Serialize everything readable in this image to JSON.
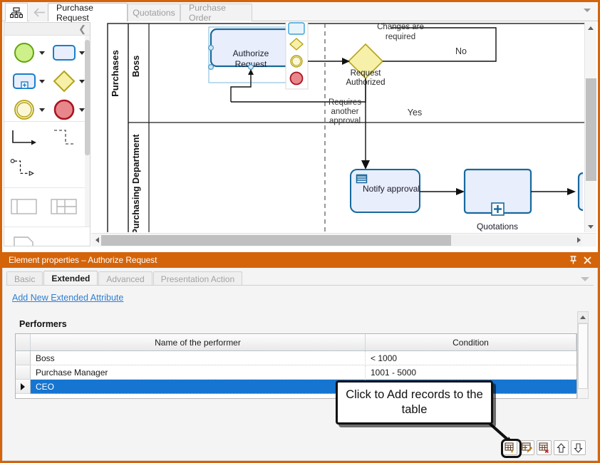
{
  "window": {
    "frame_color": "#d4640a"
  },
  "tabbar": {
    "app_icon": "org-chart-icon",
    "back_icon": "back-arrow-icon",
    "overflow_icon": "chevron-down-icon",
    "tabs": [
      {
        "label": "Purchase Request",
        "active": true
      },
      {
        "label": "Quotations",
        "active": false
      },
      {
        "label": "Purchase Order",
        "active": false
      }
    ]
  },
  "palette": {
    "collapse_icon": "chevron-left-icon",
    "groups": [
      {
        "name": "events-and-activities",
        "items": [
          {
            "icon": "start-event-circle-icon",
            "dropdown": true
          },
          {
            "icon": "task-rounded-rect-icon",
            "dropdown": true
          },
          {
            "icon": "subprocess-icon",
            "dropdown": true
          },
          {
            "icon": "gateway-diamond-icon",
            "dropdown": true
          },
          {
            "icon": "intermediate-event-icon",
            "dropdown": true
          },
          {
            "icon": "end-event-icon",
            "dropdown": true
          }
        ]
      },
      {
        "name": "connectors",
        "items": [
          {
            "icon": "sequence-flow-icon",
            "dropdown": false
          },
          {
            "icon": "message-flow-icon",
            "dropdown": false
          },
          {
            "icon": "association-flow-icon",
            "dropdown": false
          }
        ]
      },
      {
        "name": "containers",
        "items": [
          {
            "icon": "pool-icon",
            "dropdown": false
          },
          {
            "icon": "lane-grid-icon",
            "dropdown": false
          }
        ]
      },
      {
        "name": "artifacts",
        "items": [
          {
            "icon": "data-object-icon",
            "dropdown": false
          }
        ]
      }
    ]
  },
  "canvas": {
    "pool_label": "Purchases",
    "lanes": [
      {
        "label": "Boss"
      },
      {
        "label": "Purchasing Department"
      }
    ],
    "nodes": [
      {
        "id": "authorize-request",
        "type": "task",
        "label": "Authorize Request",
        "selected": true
      },
      {
        "id": "request-authorized",
        "type": "gateway",
        "label": "Request Authorized"
      },
      {
        "id": "notify-approval",
        "type": "task",
        "label": "Notify approval",
        "marker": "script-task-icon"
      },
      {
        "id": "quotations",
        "type": "subprocess",
        "label": "Quotations",
        "marker": "expand-plus-icon"
      }
    ],
    "flow_labels": [
      "Changes are required",
      "No",
      "Requires another approval",
      "Yes"
    ],
    "context_palette": [
      {
        "icon": "task-rounded-rect-icon"
      },
      {
        "icon": "gateway-diamond-icon"
      },
      {
        "icon": "intermediate-event-icon"
      },
      {
        "icon": "end-event-icon"
      }
    ],
    "scrollbars": {
      "vertical_up_icon": "triangle-up-icon",
      "vertical_down_icon": "triangle-down-icon",
      "horizontal_left_icon": "triangle-left-icon",
      "horizontal_right_icon": "triangle-right-icon"
    }
  },
  "properties_panel": {
    "title": "Element properties – Authorize Request",
    "pin_icon": "pin-icon",
    "close_icon": "close-icon",
    "overflow_icon": "chevron-down-icon",
    "tabs": [
      {
        "label": "Basic",
        "active": false
      },
      {
        "label": "Extended",
        "active": true
      },
      {
        "label": "Advanced",
        "active": false
      },
      {
        "label": "Presentation Action",
        "active": false
      }
    ],
    "add_attribute_link": "Add New Extended Attribute",
    "section_label": "Performers",
    "grid": {
      "columns": [
        "Name of the performer",
        "Condition"
      ],
      "rows": [
        {
          "name": "Boss",
          "condition": "< 1000",
          "selected": false,
          "indicator": false
        },
        {
          "name": "Purchase Manager",
          "condition": "1001 - 5000",
          "selected": false,
          "indicator": false
        },
        {
          "name": "CEO",
          "condition": "",
          "selected": true,
          "indicator": true
        }
      ]
    },
    "record_toolbar": [
      {
        "name": "add-record-button",
        "icon": "table-add-icon",
        "highlighted": true
      },
      {
        "name": "edit-record-button",
        "icon": "table-edit-icon",
        "highlighted": false
      },
      {
        "name": "delete-record-button",
        "icon": "table-delete-icon",
        "highlighted": false
      },
      {
        "name": "move-up-button",
        "icon": "arrow-up-icon",
        "highlighted": false
      },
      {
        "name": "move-down-button",
        "icon": "arrow-down-icon",
        "highlighted": false
      }
    ]
  },
  "callout": {
    "text": "Click to Add records to the table"
  }
}
